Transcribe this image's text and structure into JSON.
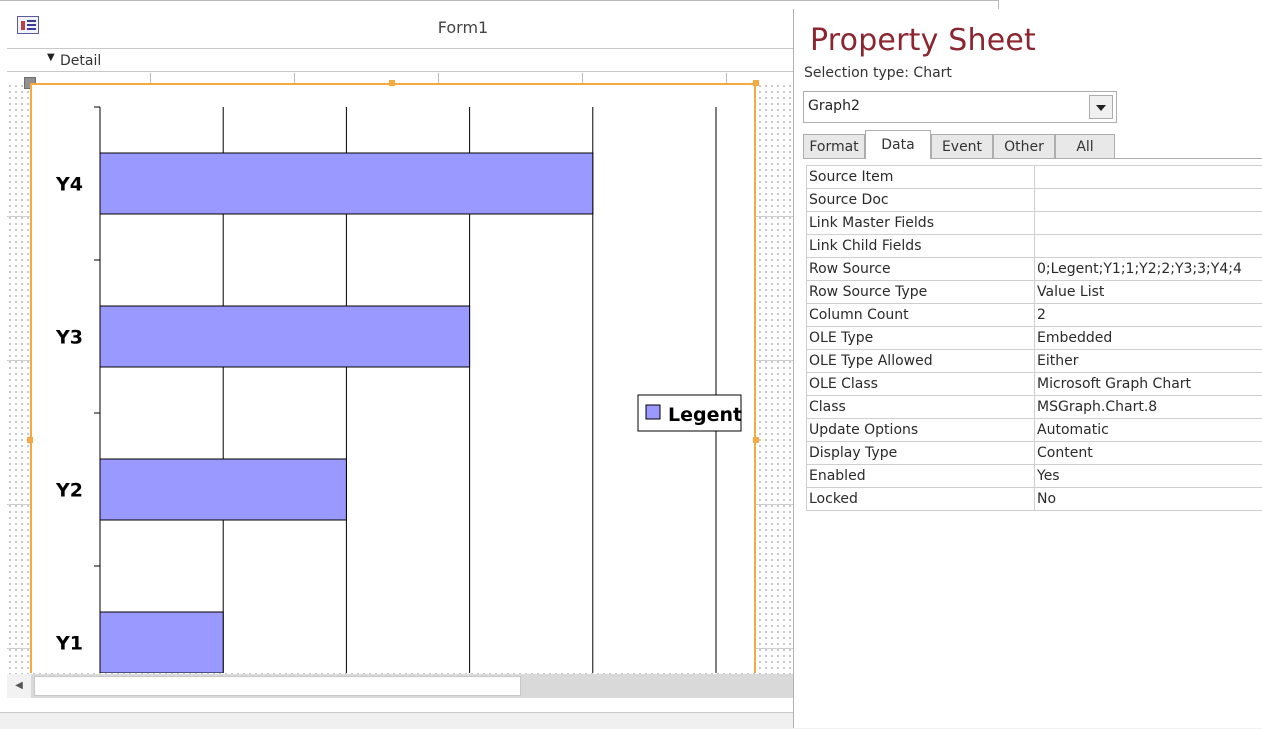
{
  "form": {
    "title": "Form1",
    "section_label": "Detail"
  },
  "chart_data": {
    "type": "bar",
    "orientation": "horizontal",
    "categories": [
      "Y1",
      "Y2",
      "Y3",
      "Y4"
    ],
    "series": [
      {
        "name": "Legent",
        "values": [
          1,
          2,
          3,
          4
        ]
      }
    ],
    "xlim": [
      0,
      5
    ],
    "grid": true,
    "legend": "right",
    "bar_color": "#9999ff"
  },
  "property_sheet": {
    "title": "Property Sheet",
    "selection_type_label": "Selection type:",
    "selection_type_value": "Chart",
    "object_name": "Graph2",
    "tabs": [
      {
        "label": "Format",
        "active": false
      },
      {
        "label": "Data",
        "active": true
      },
      {
        "label": "Event",
        "active": false
      },
      {
        "label": "Other",
        "active": false
      },
      {
        "label": "All",
        "active": false
      }
    ],
    "properties": [
      {
        "name": "Source Item",
        "value": ""
      },
      {
        "name": "Source Doc",
        "value": ""
      },
      {
        "name": "Link Master Fields",
        "value": ""
      },
      {
        "name": "Link Child Fields",
        "value": ""
      },
      {
        "name": "Row Source",
        "value": "0;Legent;Y1;1;Y2;2;Y3;3;Y4;4"
      },
      {
        "name": "Row Source Type",
        "value": "Value List"
      },
      {
        "name": "Column Count",
        "value": "2"
      },
      {
        "name": "OLE Type",
        "value": "Embedded"
      },
      {
        "name": "OLE Type Allowed",
        "value": "Either"
      },
      {
        "name": "OLE Class",
        "value": "Microsoft Graph Chart"
      },
      {
        "name": "Class",
        "value": "MSGraph.Chart.8"
      },
      {
        "name": "Update Options",
        "value": "Automatic"
      },
      {
        "name": "Display Type",
        "value": "Content"
      },
      {
        "name": "Enabled",
        "value": "Yes"
      },
      {
        "name": "Locked",
        "value": "No"
      }
    ]
  }
}
